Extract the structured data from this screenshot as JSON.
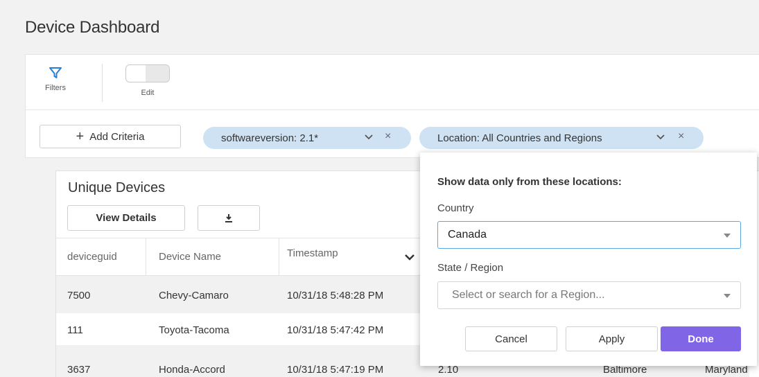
{
  "page": {
    "title": "Device Dashboard"
  },
  "toolbar": {
    "filters_label": "Filters",
    "edit_label": "Edit",
    "edit_toggle_on": false
  },
  "criteria": {
    "add_label": "Add Criteria",
    "chips": [
      {
        "label": "softwareversion: 2.1*"
      },
      {
        "label": "Location: All Countries and Regions"
      }
    ]
  },
  "card": {
    "title": "Unique Devices",
    "view_details_label": "View Details",
    "columns": [
      "deviceguid",
      "Device Name",
      "Timestamp"
    ],
    "rows": [
      {
        "deviceguid": "7500",
        "device_name": "Chevy-Camaro",
        "timestamp": "10/31/18 5:48:28 PM"
      },
      {
        "deviceguid": "111",
        "device_name": "Toyota-Tacoma",
        "timestamp": "10/31/18 5:47:42 PM"
      },
      {
        "deviceguid": "3637",
        "device_name": "Honda-Accord",
        "timestamp": "10/31/18 5:47:19 PM",
        "version": "2.10",
        "city": "Baltimore",
        "state": "Maryland"
      }
    ]
  },
  "location_popup": {
    "title": "Show data only from these locations:",
    "country_label": "Country",
    "country_value": "Canada",
    "region_label": "State / Region",
    "region_placeholder": "Select or search for a Region...",
    "cancel_label": "Cancel",
    "apply_label": "Apply",
    "done_label": "Done"
  },
  "colors": {
    "accent": "#8066e6",
    "chip": "#cfe2f3",
    "focus_border": "#5aa9e6",
    "filter_icon": "#2a7fd4"
  }
}
